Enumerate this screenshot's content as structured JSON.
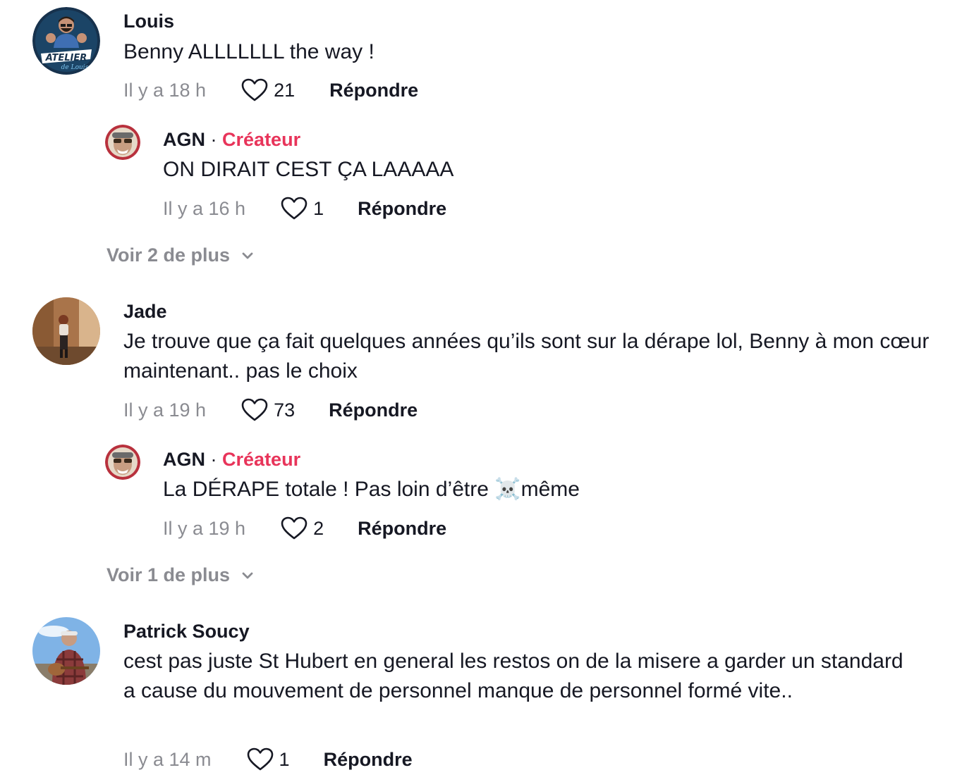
{
  "comments": [
    {
      "username": "Louis",
      "avatar_icon": "atelier-de-louis-logo",
      "text": "Benny ALLLLLLL the way !",
      "time": "Il y a 18 h",
      "likes": "21",
      "reply_label": "Répondre",
      "reply": {
        "username": "AGN",
        "badge": "Créateur",
        "separator": "·",
        "avatar_icon": "agn-avatar",
        "text": "ON DIRAIT CEST ÇA LAAAAA",
        "time": "Il y a 16 h",
        "likes": "1",
        "reply_label": "Répondre"
      },
      "more_label": "Voir 2 de plus"
    },
    {
      "username": "Jade",
      "avatar_icon": "jade-photo-avatar",
      "text": "Je trouve que ça fait quelques années qu’ils sont sur la dérape lol, Benny à mon cœur maintenant.. pas le choix",
      "time": "Il y a 19 h",
      "likes": "73",
      "reply_label": "Répondre",
      "reply": {
        "username": "AGN",
        "badge": "Créateur",
        "separator": "·",
        "avatar_icon": "agn-avatar",
        "text": "La DÉRAPE totale ! Pas loin d’être ☠️même",
        "time": "Il y a 19 h",
        "likes": "2",
        "reply_label": "Répondre"
      },
      "more_label": "Voir 1 de plus"
    },
    {
      "username": "Patrick Soucy",
      "avatar_icon": "patrick-photo-avatar",
      "text": "cest pas juste St Hubert en general les restos on de la misere a garder un standard a cause du mouvement de personnel manque de personnel formé vite..",
      "time": "Il y a 14 m",
      "likes": "1",
      "reply_label": "Répondre"
    }
  ],
  "colors": {
    "creator_badge": "#e8345a",
    "muted": "#8a8b91",
    "text": "#161823"
  },
  "logo_text": {
    "atelier_title": "ATELIER",
    "atelier_subtitle": "de Louis"
  }
}
